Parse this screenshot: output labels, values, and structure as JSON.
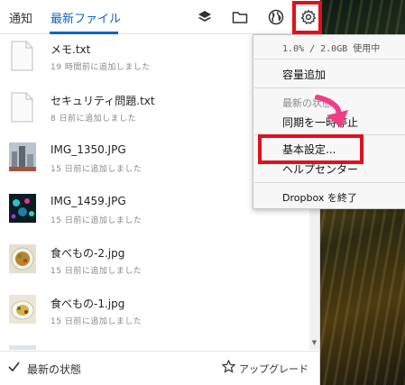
{
  "tabs": [
    {
      "label": "通知",
      "active": false
    },
    {
      "label": "最新ファイル",
      "active": true
    }
  ],
  "toolbar_icons": [
    "layers-icon",
    "folder-icon",
    "globe-icon",
    "gear-icon"
  ],
  "files": [
    {
      "name": "メモ.txt",
      "time": "19 時間前に追加しました",
      "kind": "document"
    },
    {
      "name": "セキュリティ問題.txt",
      "time": "8 日前に追加しました",
      "kind": "document"
    },
    {
      "name": "IMG_1350.JPG",
      "time": "15 日前に追加しました",
      "kind": "photo-city"
    },
    {
      "name": "IMG_1459.JPG",
      "time": "15 日前に追加しました",
      "kind": "photo-lights"
    },
    {
      "name": "食べもの-2.jpg",
      "time": "15 日前に追加しました",
      "kind": "photo-food"
    },
    {
      "name": "食べもの-1.jpg",
      "time": "15 日前に追加しました",
      "kind": "photo-food"
    }
  ],
  "bottom": {
    "status_label": "最新の状態",
    "upgrade_label": "アップグレード"
  },
  "settings_menu": {
    "usage": "1.0% / 2.0GB 使用中",
    "add_space": "容量追加",
    "status_hint": "最新の状態",
    "pause_sync": "同期を一時停止",
    "preferences": "基本設定...",
    "help_center": "ヘルプセンター",
    "quit": "Dropbox を終了"
  },
  "colors": {
    "accent": "#0a63c9",
    "highlight": "#e0101e",
    "arrow": "#ef3e86"
  }
}
